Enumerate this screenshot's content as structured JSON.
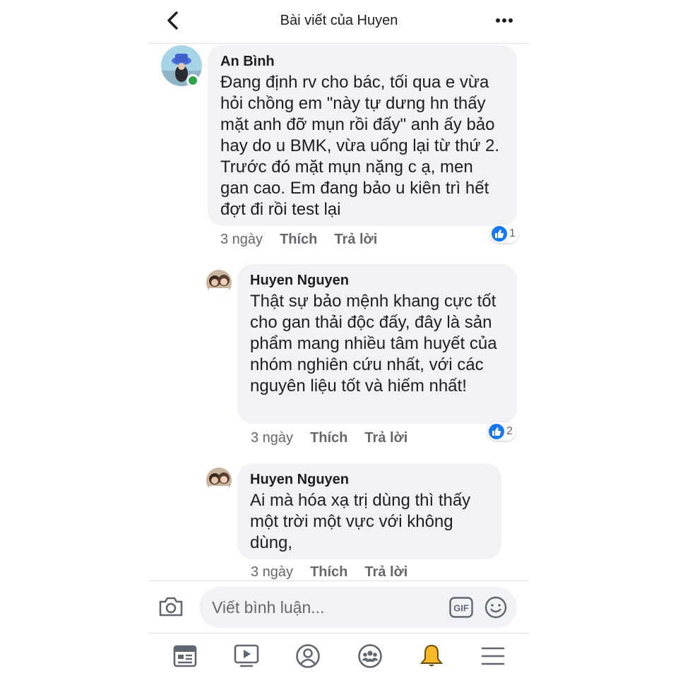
{
  "header": {
    "title": "Bài viết của Huyen",
    "back_icon": "chevron-left-icon",
    "more_icon": "more-horizontal-icon"
  },
  "comments": [
    {
      "author": "An Bình",
      "text": "Đang định rv cho bác, tối qua e vừa hỏi chồng em \"này tự dưng hn thấy mặt anh đỡ mụn rồi đấy\" anh ấy bảo hay do u BMK, vừa uống lại từ thứ 2. Trước đó mặt mụn nặng c ạ, men gan cao. Em đang bảo u kiên trì hết đợt đi rồi test lại",
      "time": "3 ngày",
      "like_label": "Thích",
      "reply_label": "Trả lời",
      "reaction_count": "1",
      "online": true
    },
    {
      "author": "Huyen Nguyen",
      "text": "Thật sự bảo mệnh khang cực tốt cho gan thải độc đấy, đây là sản phẩm mang nhiều tâm huyết của nhóm nghiên cứu nhất, với các nguyên liệu tốt và hiếm nhất!",
      "time": "3 ngày",
      "like_label": "Thích",
      "reply_label": "Trả lời",
      "reaction_count": "2"
    },
    {
      "author": "Huyen Nguyen",
      "text": "Ai mà hóa xạ trị dùng thì thấy một trời một vực với không dùng,",
      "time": "3 ngày",
      "like_label": "Thích",
      "reply_label": "Trả lời"
    }
  ],
  "composer": {
    "placeholder": "Viết bình luận...",
    "gif_label": "GIF",
    "camera_icon": "camera-icon",
    "emoji_icon": "smiley-icon"
  },
  "nav": [
    "news-feed-icon",
    "watch-video-icon",
    "profile-icon",
    "groups-icon",
    "notifications-bell-icon",
    "menu-icon"
  ],
  "colors": {
    "bubble": "#f0f2f5",
    "like_blue": "#1877f2",
    "online_green": "#31a24c",
    "bell_yellow": "#f7b928",
    "secondary_text": "#65676b"
  }
}
